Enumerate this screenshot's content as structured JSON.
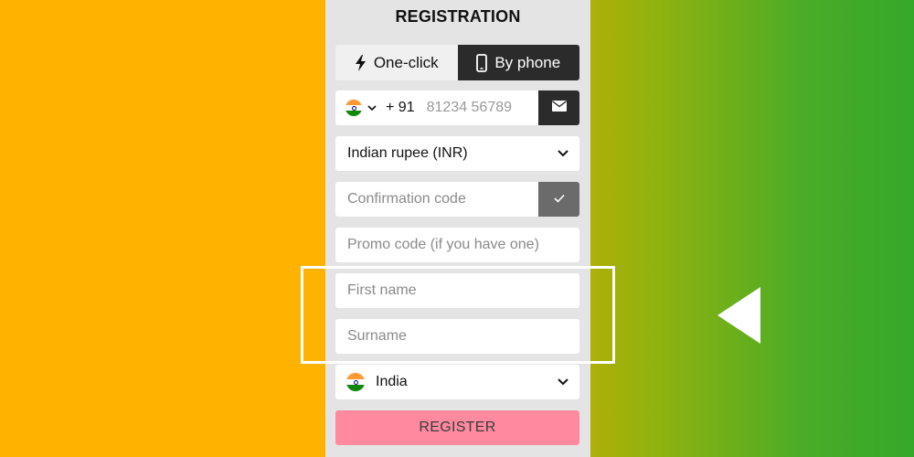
{
  "form": {
    "title": "REGISTRATION",
    "tabs": [
      {
        "label": "One-click",
        "icon": "lightning-icon",
        "active": false
      },
      {
        "label": "By phone",
        "icon": "phone-icon",
        "active": true
      }
    ],
    "phone": {
      "country_flag": "india-flag-icon",
      "dial_code": "+ 91",
      "placeholder": "81234 56789"
    },
    "currency": {
      "value": "Indian rupee (INR)"
    },
    "confirmation": {
      "placeholder": "Confirmation code"
    },
    "promo": {
      "placeholder": "Promo code (if you have one)"
    },
    "first_name": {
      "placeholder": "First name"
    },
    "surname": {
      "placeholder": "Surname"
    },
    "country": {
      "value": "India"
    },
    "register_label": "REGISTER"
  },
  "colors": {
    "background_left": "#ffb300",
    "background_right": "#35a82a",
    "panel": "#e4e4e4",
    "dark_button": "#2b2b2b",
    "check_button": "#6b6b6b",
    "register_button": "#ff8aa0",
    "highlight": "#ffffff"
  }
}
